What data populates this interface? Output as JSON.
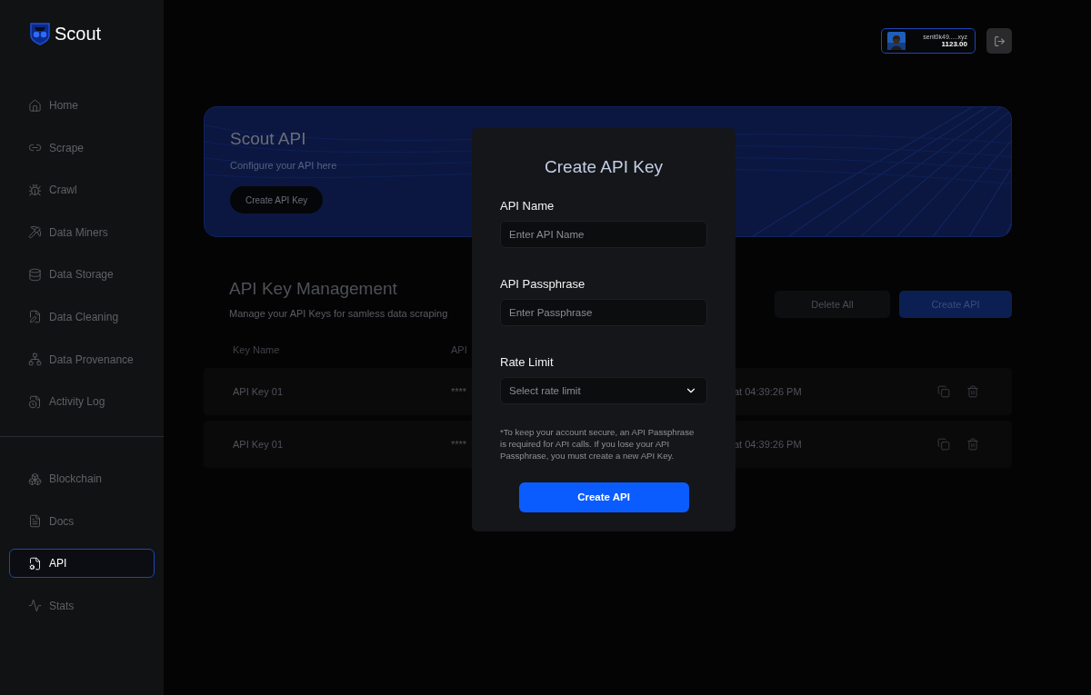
{
  "sidebar": {
    "logo": "Scout",
    "main_items": [
      {
        "label": "Home",
        "selected": false
      },
      {
        "label": "Scrape",
        "selected": false
      },
      {
        "label": "Crawl",
        "selected": false
      },
      {
        "label": "Data Miners",
        "selected": false
      },
      {
        "label": "Data Storage",
        "selected": false
      },
      {
        "label": "Data Cleaning",
        "selected": false
      },
      {
        "label": "Data Provenance",
        "selected": false
      },
      {
        "label": "Activity Log",
        "selected": false
      }
    ],
    "bottom_items": [
      {
        "label": "Blockchain",
        "selected": false
      },
      {
        "label": "Docs",
        "selected": false
      },
      {
        "label": "API",
        "selected": true
      },
      {
        "label": "Stats",
        "selected": false
      }
    ]
  },
  "account": {
    "wallet": "sent0k49.....xyz",
    "balance": "1123.00"
  },
  "banner": {
    "title": "Scout API",
    "subtitle": "Configure your API here",
    "button": "Create API Key"
  },
  "management": {
    "title": "API Key Management",
    "subtitle": "Manage your API Keys for samless data scraping",
    "buttons": {
      "delete_all": "Delete All",
      "create": "Create API"
    },
    "columns": [
      "Key Name",
      "API"
    ],
    "rows": [
      {
        "name": "API Key 01",
        "key": "****",
        "created": "at 04:39:26 PM"
      },
      {
        "name": "API Key 01",
        "key": "****",
        "created": "at 04:39:26 PM"
      }
    ]
  },
  "dialog": {
    "title": "Create API Key",
    "fields": [
      {
        "kind": "text",
        "label": "API Name",
        "placeholder": "Enter API Name"
      },
      {
        "kind": "text",
        "label": "API Passphrase",
        "placeholder": "Enter Passphrase"
      },
      {
        "kind": "select",
        "label": "Rate Limit",
        "placeholder": "Select rate limit"
      }
    ],
    "note": "*To keep your account secure, an API Passphrase is required for API calls. If you lose your API Passphrase, you must create a new API Key.",
    "submit": "Create API"
  }
}
